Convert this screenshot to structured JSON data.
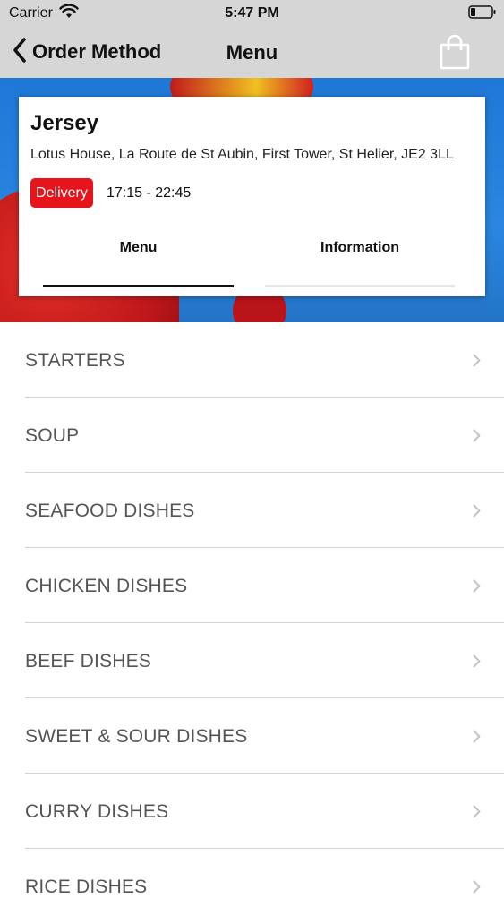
{
  "status_bar": {
    "carrier": "Carrier",
    "time": "5:47 PM"
  },
  "nav": {
    "back_label": "Order Method",
    "title": "Menu"
  },
  "store": {
    "name": "Jersey",
    "address": "Lotus House, La Route de St Aubin, First Tower, St Helier, JE2 3LL",
    "order_type": "Delivery",
    "hours": "17:15 - 22:45"
  },
  "tabs": [
    {
      "label": "Menu",
      "selected": true
    },
    {
      "label": "Information",
      "selected": false
    }
  ],
  "categories": [
    {
      "label": "STARTERS"
    },
    {
      "label": "SOUP"
    },
    {
      "label": "SEAFOOD DISHES"
    },
    {
      "label": "CHICKEN DISHES"
    },
    {
      "label": "BEEF DISHES"
    },
    {
      "label": "SWEET & SOUR DISHES"
    },
    {
      "label": "CURRY DISHES"
    },
    {
      "label": "RICE DISHES"
    }
  ],
  "colors": {
    "accent": "#e8141b",
    "nav_background": "#d6d6d6",
    "category_text": "#555555"
  },
  "icons": {
    "back": "chevron-left-icon",
    "cart": "shopping-bag-icon",
    "row": "chevron-right-icon",
    "wifi": "wifi-icon",
    "battery": "battery-icon"
  }
}
